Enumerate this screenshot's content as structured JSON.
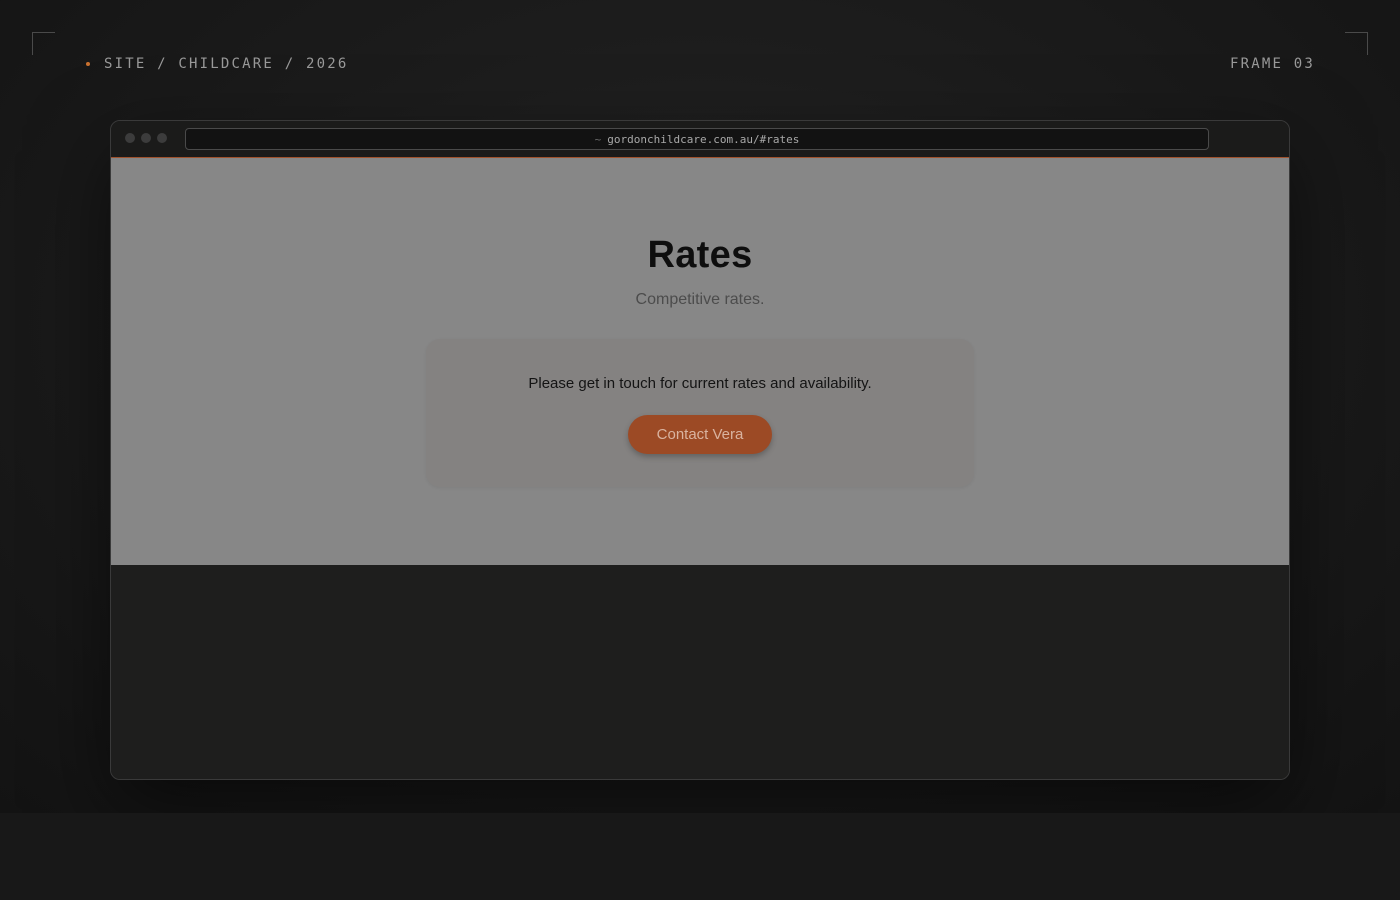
{
  "header": {
    "breadcrumb": "SITE / CHILDCARE / 2026",
    "frame_label": "FRAME 03"
  },
  "browser": {
    "url_prefix": "~",
    "url": "gordonchildcare.com.au/#rates"
  },
  "page": {
    "title": "Rates",
    "subtitle": "Competitive rates.",
    "card_text": "Please get in touch for current rates and availability.",
    "cta_label": "Contact Vera"
  },
  "colors": {
    "accent": "#c9712f",
    "button": "#9c4a25",
    "viewport_bg": "#878787"
  }
}
